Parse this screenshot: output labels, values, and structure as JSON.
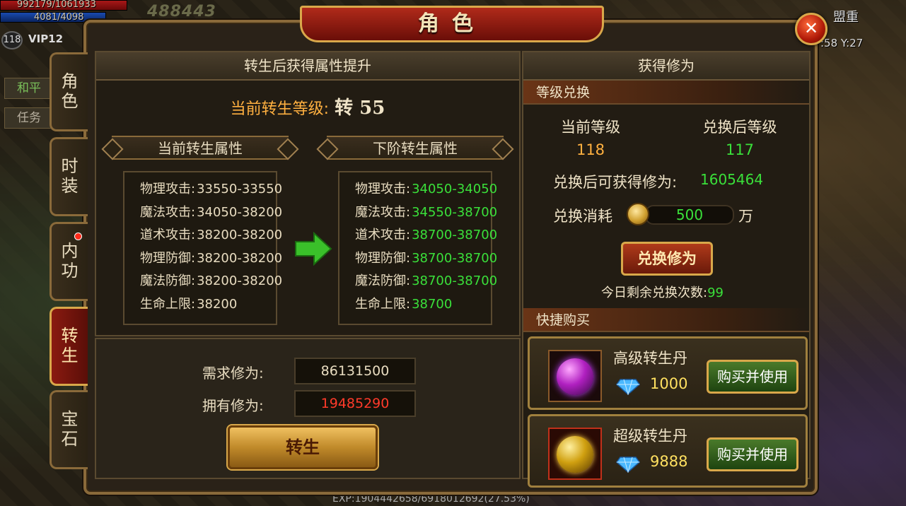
{
  "hud": {
    "hp": "992179/1061933",
    "mp": "4081/4098",
    "score": "488443",
    "level": "118",
    "vip": "VIP12",
    "peace_label": "和平",
    "task_label": "任务",
    "weight_label": "盟重",
    "coords": ":58 Y:27",
    "exp": "EXP:1904442658/6918012692(27.53%)"
  },
  "window": {
    "title": "角色"
  },
  "tabs": [
    {
      "label": "角色",
      "active": false
    },
    {
      "label": "时装",
      "active": false
    },
    {
      "label": "内功",
      "active": false,
      "has_dot": true
    },
    {
      "label": "转生",
      "active": true
    },
    {
      "label": "宝石",
      "active": false
    }
  ],
  "rebirth": {
    "header": "转生后获得属性提升",
    "current_level_label": "当前转生等级:",
    "current_level_value": "转 55",
    "current_title": "当前转生属性",
    "next_title": "下阶转生属性",
    "current_attrs": [
      {
        "label": "物理攻击:",
        "value": "33550-33550"
      },
      {
        "label": "魔法攻击:",
        "value": "34050-38200"
      },
      {
        "label": "道术攻击:",
        "value": "38200-38200"
      },
      {
        "label": "物理防御:",
        "value": "38200-38200"
      },
      {
        "label": "魔法防御:",
        "value": "38200-38200"
      },
      {
        "label": "生命上限:",
        "value": "38200"
      }
    ],
    "next_attrs": [
      {
        "label": "物理攻击:",
        "value": "34050-34050"
      },
      {
        "label": "魔法攻击:",
        "value": "34550-38700"
      },
      {
        "label": "道术攻击:",
        "value": "38700-38700"
      },
      {
        "label": "物理防御:",
        "value": "38700-38700"
      },
      {
        "label": "魔法防御:",
        "value": "38700-38700"
      },
      {
        "label": "生命上限:",
        "value": "38700"
      }
    ],
    "required_label": "需求修为:",
    "required_value": "86131500",
    "owned_label": "拥有修为:",
    "owned_value": "19485290",
    "button_label": "转生"
  },
  "cultivation": {
    "header": "获得修为",
    "exchange_section": "等级兑换",
    "current_level_label": "当前等级",
    "after_level_label": "兑换后等级",
    "current_level": "118",
    "after_level": "117",
    "gain_label": "兑换后可获得修为:",
    "gain_value": "1605464",
    "cost_label": "兑换消耗",
    "cost_value": "500",
    "cost_unit": "万",
    "exchange_button": "兑换修为",
    "remaining_label": "今日剩余兑换次数:",
    "remaining_value": "99",
    "shop_section": "快捷购买",
    "items": [
      {
        "name": "高级转生丹",
        "price": "1000",
        "button": "购买并使用",
        "icon": "purple-orb-icon"
      },
      {
        "name": "超级转生丹",
        "price": "9888",
        "button": "购买并使用",
        "icon": "gold-orb-icon"
      }
    ]
  }
}
